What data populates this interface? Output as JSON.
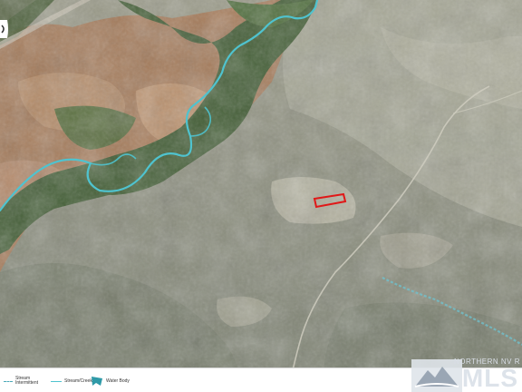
{
  "map": {
    "type": "satellite",
    "colors": {
      "river": "#4fc3cf",
      "stream": "#4aa8b8",
      "parcel": "#e01818",
      "vegetation": "#3e5a30",
      "farmland": "#a57a58",
      "terrain": "#8c8f7a"
    },
    "features": [
      "river",
      "parcel-outline",
      "dirt-road",
      "stream"
    ]
  },
  "legend": {
    "items": [
      {
        "label_top": "Stream",
        "label_bottom": "Intermittent",
        "icon": "dashed-stream-line"
      },
      {
        "label_top": "Stream/Creek",
        "label_bottom": "",
        "icon": "solid-creek-line"
      },
      {
        "label_top": "Water Body",
        "label_bottom": "",
        "icon": "water-body-swatch"
      }
    ]
  },
  "logo": {
    "org": "NORTHERN NV R",
    "brand": "MLS"
  }
}
